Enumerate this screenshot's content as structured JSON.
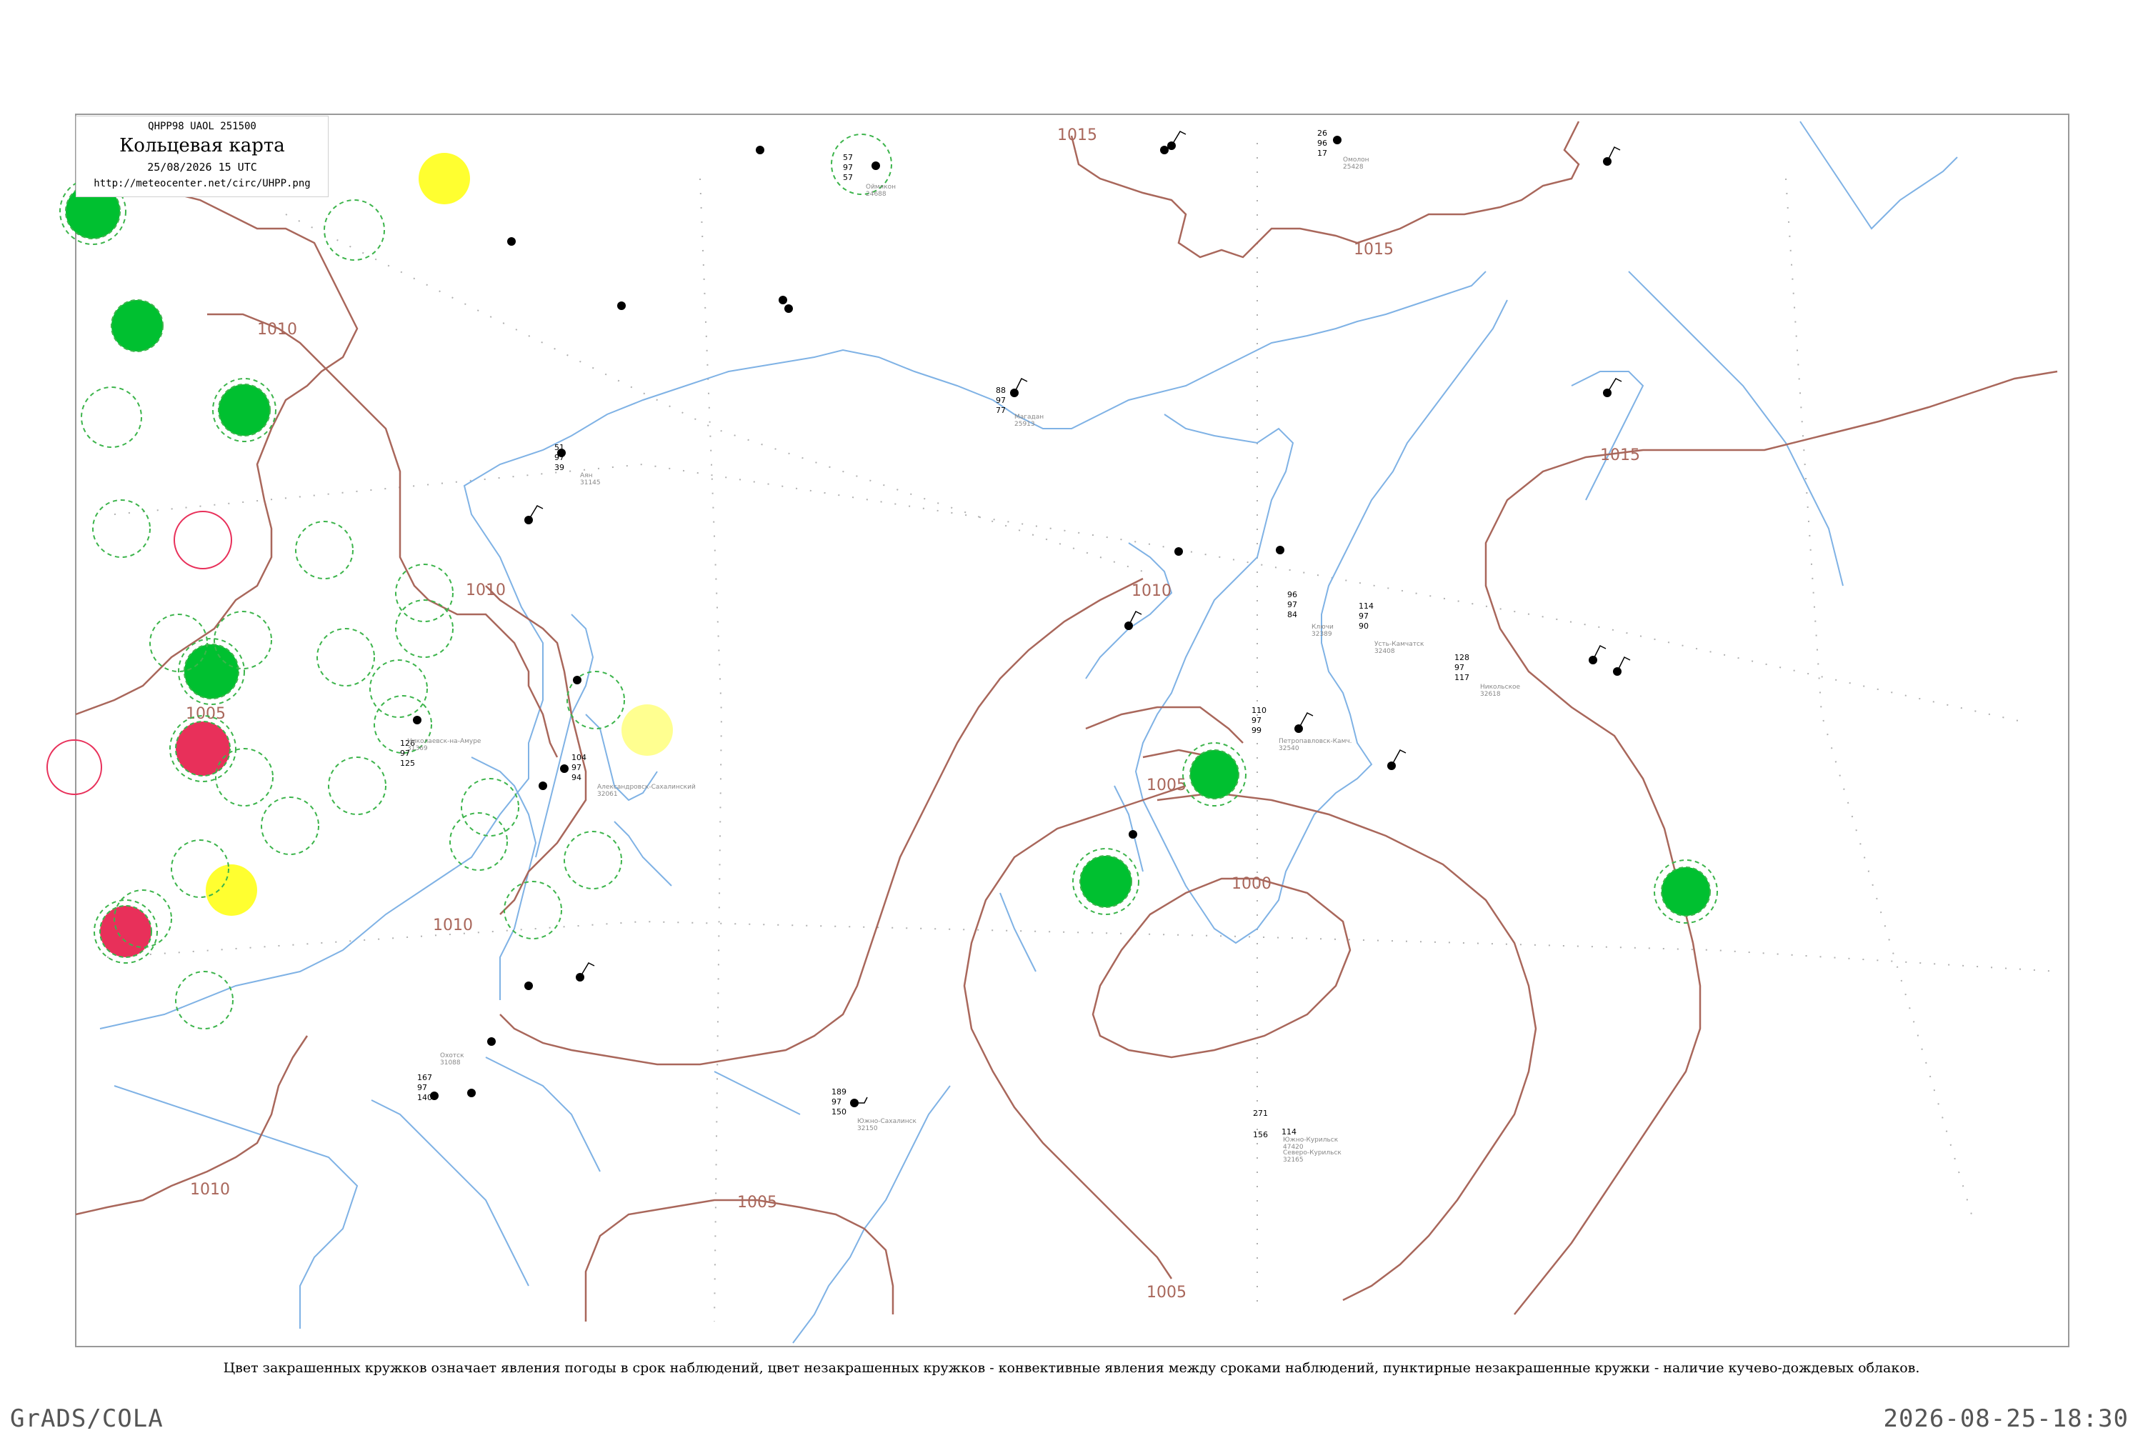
{
  "header": {
    "code": "QHPP98  UAOL  251500",
    "title": "Кольцевая карта",
    "datetime": "25/08/2026 15 UTC",
    "url": "http://meteocenter.net/circ/UHPP.png"
  },
  "caption": "Цвет закрашенных кружков означает явления погоды в срок наблюдений, цвет незакрашенных кружков - конвективные явления между сроками наблюдений, пунктирные незакрашенные кружки - наличие кучево-дождевых облаков.",
  "footer": {
    "left": "GrADS/COLA",
    "right": "2026-08-25-18:30"
  },
  "isobars": [
    "1015",
    "1015",
    "1015",
    "1010",
    "1010",
    "1010",
    "1010",
    "1010",
    "1005",
    "1005",
    "1005",
    "1005",
    "1000"
  ],
  "stations": [
    {
      "name": "Усть-Камчатск",
      "id": "32408",
      "top": "114",
      "mid": "97",
      "bot": "90"
    },
    {
      "name": "Ключи",
      "id": "32389",
      "top": "96",
      "mid": "97",
      "bot": "84"
    },
    {
      "name": "Петропавловск-Камч.",
      "id": "32540",
      "top": "110",
      "mid": "97",
      "bot": "99"
    },
    {
      "name": "Охотск",
      "id": "31088",
      "top": "167",
      "mid": "97",
      "bot": "140"
    },
    {
      "name": "Магадан",
      "id": "25913",
      "top": "88",
      "mid": "97",
      "bot": "77"
    },
    {
      "name": "Никольское",
      "id": "32618",
      "top": "128",
      "mid": "97",
      "bot": "117"
    },
    {
      "name": "Южно-Курильск",
      "id": "47420",
      "top": "271",
      "mid": "",
      "bot": "156"
    },
    {
      "name": "Николаевск-на-Амуре",
      "id": "31369",
      "top": "126",
      "mid": "97",
      "bot": "125"
    },
    {
      "name": "Аян",
      "id": "31145",
      "top": "51",
      "mid": "97",
      "bot": "39"
    },
    {
      "name": "Оймякон",
      "id": "24688",
      "top": "57",
      "mid": "97",
      "bot": "57"
    },
    {
      "name": "Александровск-Сахалинский",
      "id": "32061",
      "top": "104",
      "mid": "97",
      "bot": "94"
    },
    {
      "name": "Южно-Сахалинск",
      "id": "32150",
      "top": "189",
      "mid": "97",
      "bot": "150"
    },
    {
      "name": "Северо-Курильск",
      "id": "32165",
      "top": "",
      "mid": "",
      "bot": "114"
    },
    {
      "name": "Омолон",
      "id": "25428",
      "top": "26",
      "mid": "96",
      "bot": "17"
    }
  ],
  "colors": {
    "coast": "#7fb2e5",
    "isobar": "#a9675b",
    "green_fill": "#00c030",
    "green_ring": "#3cb44b",
    "red_fill": "#e8305a",
    "yellow_fill": "#ffff30",
    "pale_yellow_fill": "#ffff90",
    "frame": "#999999"
  }
}
